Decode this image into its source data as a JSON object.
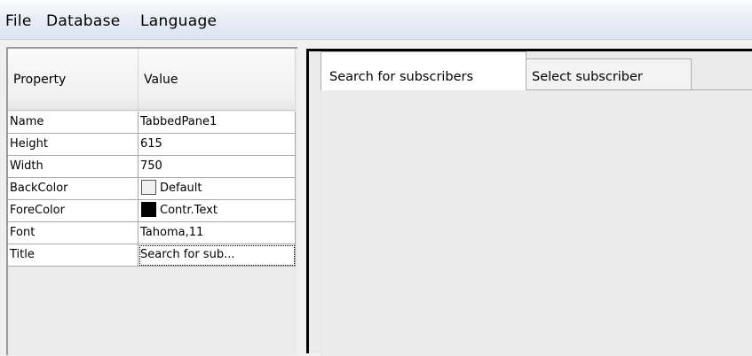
{
  "menu": {
    "items": [
      "File",
      "Database",
      "Language"
    ]
  },
  "property_grid": {
    "header": {
      "property": "Property",
      "value": "Value"
    },
    "rows": [
      {
        "name": "Name",
        "value": "TabbedPane1"
      },
      {
        "name": "Height",
        "value": "615"
      },
      {
        "name": "Width",
        "value": "750"
      },
      {
        "name": "BackColor",
        "value": "Default",
        "swatch": "#f0f0f0"
      },
      {
        "name": "ForeColor",
        "value": "Contr.Text",
        "swatch": "#000000"
      },
      {
        "name": "Font",
        "value": "Tahoma,11"
      },
      {
        "name": "Title",
        "value": "Search for sub..."
      }
    ]
  },
  "tabs": [
    {
      "label": "Search for subscribers",
      "active": true
    },
    {
      "label": "Select subscriber",
      "active": false
    }
  ],
  "colors": {
    "menubar_gradient_top": "#fbfcfd",
    "menubar_gradient_bottom": "#dde5f0",
    "frame_border": "#000000",
    "panel_bg": "#f0f0f0"
  }
}
